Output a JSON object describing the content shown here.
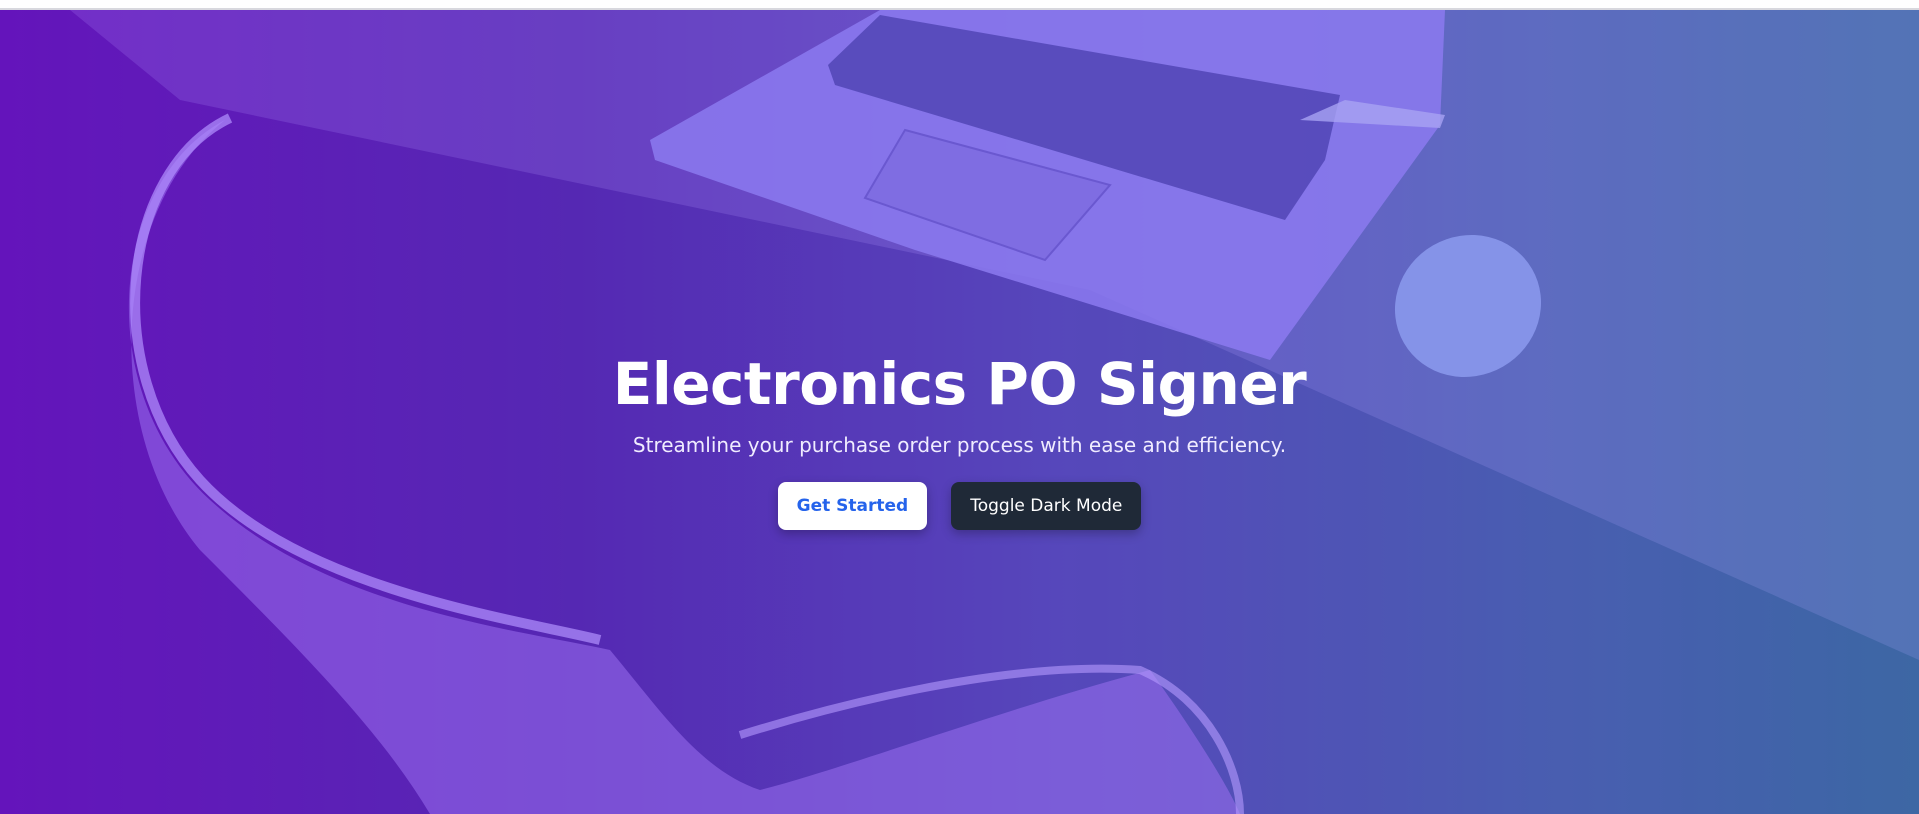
{
  "hero": {
    "title": "Electronics PO Signer",
    "subtitle": "Streamline your purchase order process with ease and efficiency.",
    "get_started_label": "Get Started",
    "toggle_dark_label": "Toggle Dark Mode"
  },
  "colors": {
    "gradient_start": "#6a14c0",
    "gradient_end": "#3f6ea8",
    "primary_button_bg": "#ffffff",
    "primary_button_text": "#2563eb",
    "dark_button_bg": "#1f2937",
    "dark_button_text": "#ffffff"
  }
}
